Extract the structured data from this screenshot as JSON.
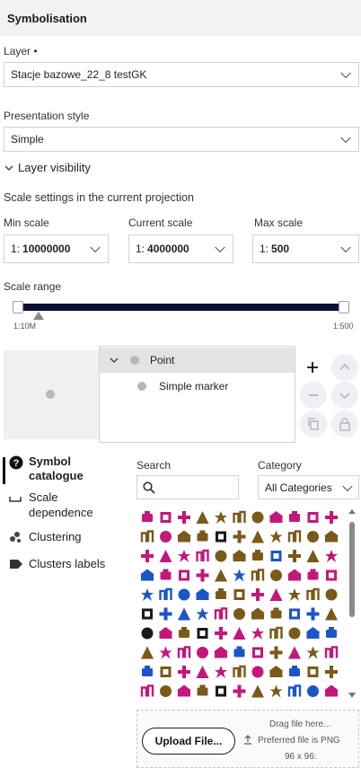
{
  "header": {
    "title": "Symbolisation"
  },
  "layer": {
    "label": "Layer •",
    "value": "Stacje bazowe_22_8 testGK"
  },
  "presentation": {
    "label": "Presentation style",
    "value": "Simple"
  },
  "visibility": {
    "label": "Layer visibility"
  },
  "scale_settings": {
    "title": "Scale settings in the current projection",
    "min": {
      "label": "Min scale",
      "prefix": "1:",
      "value": "10000000"
    },
    "current": {
      "label": "Current scale",
      "prefix": "1:",
      "value": "4000000"
    },
    "max": {
      "label": "Max scale",
      "prefix": "1:",
      "value": "500"
    }
  },
  "scale_range": {
    "label": "Scale range",
    "left_tick": "1:10M",
    "right_tick": "1:500"
  },
  "tree": {
    "parent": "Point",
    "child": "Simple marker"
  },
  "side_menu": {
    "items": [
      {
        "label": "Symbol catalogue",
        "icon": "question-circle-icon",
        "active": true
      },
      {
        "label": "Scale dependence",
        "icon": "scale-bracket-icon",
        "active": false
      },
      {
        "label": "Clustering",
        "icon": "cluster-dots-icon",
        "active": false
      },
      {
        "label": "Clusters labels",
        "icon": "tag-icon",
        "active": false
      }
    ]
  },
  "search": {
    "label": "Search",
    "value": ""
  },
  "category": {
    "label": "Category",
    "value": "All Categories"
  },
  "symbols": {
    "colors": [
      "#c2187a",
      "#7a5a1a",
      "#1d55c7",
      "#1a1a1a"
    ],
    "rows": [
      [
        0,
        0,
        0,
        1,
        1,
        1,
        1,
        0,
        0,
        0,
        0
      ],
      [
        1,
        0,
        1,
        1,
        3,
        1,
        1,
        1,
        1,
        1,
        1
      ],
      [
        0,
        0,
        0,
        0,
        1,
        1,
        1,
        2,
        1,
        1,
        0
      ],
      [
        2,
        0,
        0,
        0,
        1,
        2,
        1,
        1,
        0,
        0,
        0
      ],
      [
        2,
        2,
        2,
        2,
        1,
        1,
        0,
        0,
        1,
        1,
        1
      ],
      [
        3,
        2,
        2,
        2,
        0,
        1,
        1,
        1,
        2,
        2,
        1
      ],
      [
        3,
        0,
        1,
        3,
        0,
        0,
        0,
        1,
        1,
        2,
        2
      ],
      [
        1,
        0,
        0,
        0,
        0,
        2,
        0,
        1,
        0,
        1,
        0
      ],
      [
        2,
        1,
        0,
        0,
        0,
        1,
        0,
        1,
        2,
        1,
        1
      ],
      [
        0,
        1,
        0,
        1,
        3,
        0,
        1,
        1,
        2,
        2,
        0
      ]
    ]
  },
  "upload": {
    "button": "Upload File...",
    "hint1": "Drag file here...",
    "hint2": "Preferred file is PNG",
    "hint3": "96 x 96:"
  }
}
